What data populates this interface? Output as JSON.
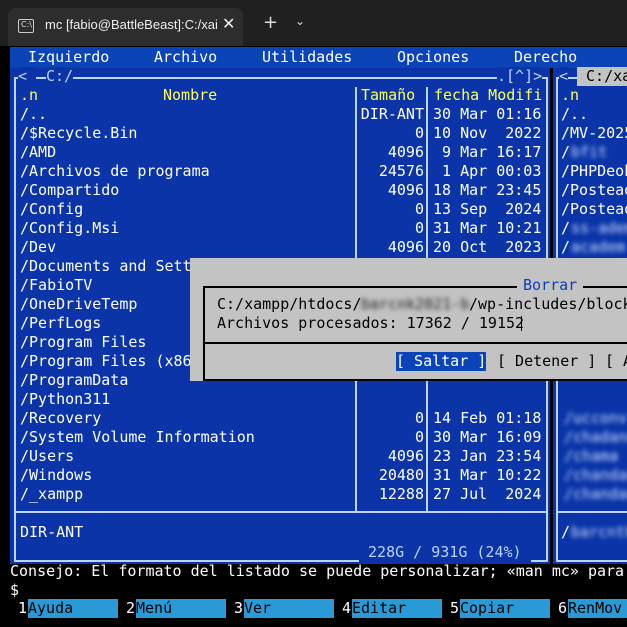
{
  "window": {
    "tab_title": "mc [fabio@BattleBeast]:C:/xai",
    "tab_icon": "terminal-icon",
    "close_glyph": "✕",
    "new_tab_glyph": "+",
    "dropdown_glyph": "⌄"
  },
  "menubar": [
    "Izquierdo",
    "Archivo",
    "Utilidades",
    "Opciones",
    "Derecho"
  ],
  "left_panel": {
    "path": "C:/",
    "top_right_controls": ".[^]>",
    "columns": {
      "sort": ".n",
      "name": "Nombre",
      "size": "Tamaño",
      "date": "fecha Modifi"
    },
    "rows": [
      {
        "name": "/..",
        "size": "DIR-ANT",
        "date": "30 Mar 01:16"
      },
      {
        "name": "/$Recycle.Bin",
        "size": "0",
        "date": "10 Nov  2022"
      },
      {
        "name": "/AMD",
        "size": "4096",
        "date": " 9 Mar 16:17"
      },
      {
        "name": "/Archivos de programa",
        "size": "24576",
        "date": " 1 Apr 00:03"
      },
      {
        "name": "/Compartido",
        "size": "4096",
        "date": "18 Mar 23:45"
      },
      {
        "name": "/Config",
        "size": "0",
        "date": "13 Sep  2024"
      },
      {
        "name": "/Config.Msi",
        "size": "0",
        "date": "31 Mar 10:21"
      },
      {
        "name": "/Dev",
        "size": "4096",
        "date": "20 Oct  2023"
      },
      {
        "name": "/Documents and Sett",
        "size": "",
        "date": ""
      },
      {
        "name": "/FabioTV",
        "size": "",
        "date": ""
      },
      {
        "name": "/OneDriveTemp",
        "size": "",
        "date": ""
      },
      {
        "name": "/PerfLogs",
        "size": "",
        "date": ""
      },
      {
        "name": "/Program Files",
        "size": "",
        "date": ""
      },
      {
        "name": "/Program Files (x86",
        "size": "",
        "date": ""
      },
      {
        "name": "/ProgramData",
        "size": "",
        "date": ""
      },
      {
        "name": "/Python311",
        "size": "",
        "date": ""
      },
      {
        "name": "/Recovery",
        "size": "0",
        "date": "14 Feb 01:18"
      },
      {
        "name": "/System Volume Information",
        "size": "0",
        "date": "30 Mar 16:09"
      },
      {
        "name": "/Users",
        "size": "4096",
        "date": "23 Jan 23:54"
      },
      {
        "name": "/Windows",
        "size": "20480",
        "date": "31 Mar 10:22"
      },
      {
        "name": "/_xampp",
        "size": "12288",
        "date": "27 Jul  2024"
      }
    ],
    "status": "DIR-ANT",
    "disk": " 228G / 931G (24%) "
  },
  "right_panel": {
    "path": " C:/xa",
    "sort": ".n",
    "rows": [
      "/..",
      "/MV-2025",
      "/",
      "/PHPDeob",
      "/Postead",
      "/Postead",
      "/",
      "/"
    ],
    "status_row": "/"
  },
  "dialog": {
    "title": "Borrar",
    "path_prefix": "C:/xampp/htdocs/",
    "path_suffix": "/wp-includes/block",
    "progress_label": "Archivos procesados: 17362 / 19152",
    "progress_current": 17362,
    "progress_total": 19152,
    "buttons": [
      {
        "label": "[ Saltar ]"
      },
      {
        "label": "[ Detener ]"
      },
      {
        "label": "[ A"
      }
    ]
  },
  "hint": "Consejo: El formato del listado se puede personalizar; «man mc» para",
  "prompt": "$",
  "fkeys": [
    {
      "num": "1",
      "label": "Ayuda"
    },
    {
      "num": "2",
      "label": "Menú"
    },
    {
      "num": "3",
      "label": "Ver"
    },
    {
      "num": "4",
      "label": "Editar"
    },
    {
      "num": "5",
      "label": "Copiar"
    },
    {
      "num": "6",
      "label": "RenMov"
    }
  ],
  "colors": {
    "panel_bg": "#0a34a8",
    "menu_bg": "#0a44b6",
    "dialog_bg": "#c3c3c3",
    "fkey_bg": "#2a9ad6",
    "header_text": "#ffff55"
  }
}
